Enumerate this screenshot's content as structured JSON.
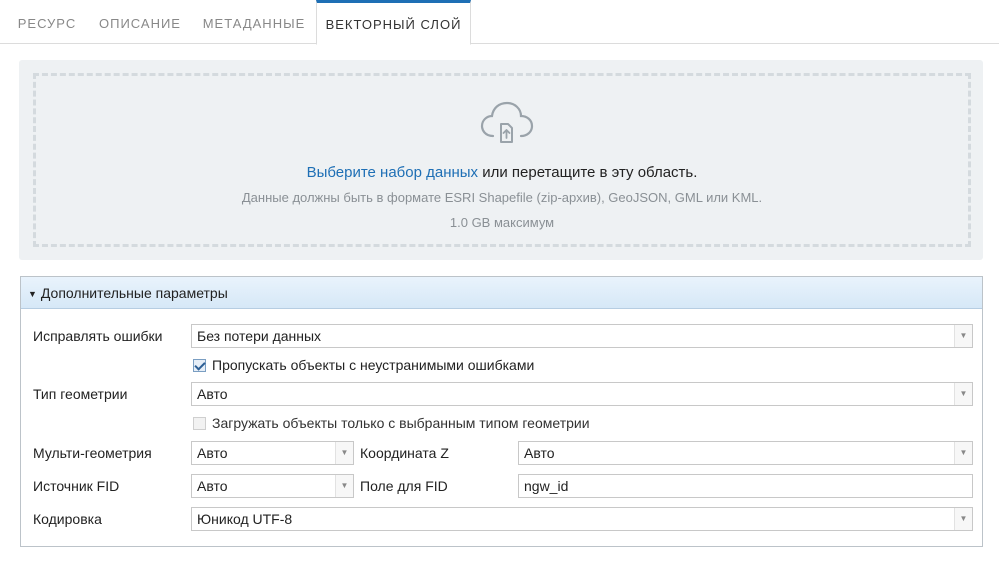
{
  "tabs": [
    {
      "label": "Ресурс",
      "active": false
    },
    {
      "label": "Описание",
      "active": false
    },
    {
      "label": "Метаданные",
      "active": false
    },
    {
      "label": "Векторный слой",
      "active": true
    }
  ],
  "upload": {
    "icon": "cloud-upload-icon",
    "link_text": "Выберите набор данных",
    "rest_text": " или перетащите в эту область.",
    "formats_text": "Данные должны быть в формате ESRI Shapefile (zip-архив), GeoJSON, GML или KML.",
    "size_limit": "1.0 GB максимум"
  },
  "advanced": {
    "title": "Дополнительные параметры",
    "expanded": true,
    "fix_errors": {
      "label": "Исправлять ошибки",
      "value": "Без потери данных"
    },
    "skip_errors": {
      "label": "Пропускать объекты с неустранимыми ошибками",
      "checked": true
    },
    "geometry_type": {
      "label": "Тип геометрии",
      "value": "Авто"
    },
    "only_geom_type": {
      "label": "Загружать объекты только с выбранным типом геометрии",
      "checked": false
    },
    "multi_geometry": {
      "label": "Мульти-геометрия",
      "value": "Авто"
    },
    "z_coord": {
      "label": "Координата Z",
      "value": "Авто"
    },
    "fid_source": {
      "label": "Источник FID",
      "value": "Авто"
    },
    "fid_field": {
      "label": "Поле для FID",
      "value": "ngw_id"
    },
    "encoding": {
      "label": "Кодировка",
      "value": "Юникод UTF-8"
    }
  },
  "colors": {
    "accent": "#1e6fb5",
    "header_bg": "#d6e8f7",
    "upload_bg": "#eef1f3"
  }
}
